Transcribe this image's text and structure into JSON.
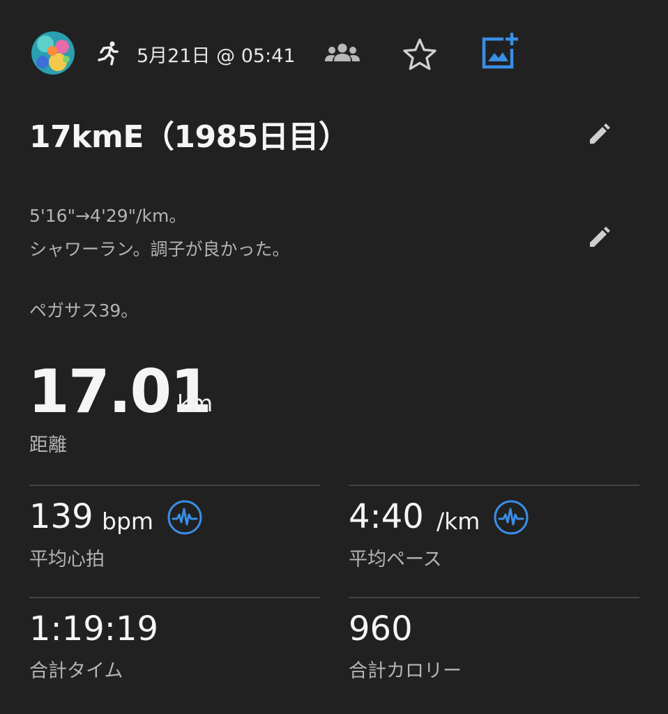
{
  "header": {
    "date_time": "5月21日 @ 05:41",
    "icons": {
      "avatar": "profile-avatar",
      "activity": "running-icon",
      "privacy": "group-icon",
      "favorite": "star-icon",
      "add_photo": "add-photo-icon"
    },
    "accent_color": "#3a8ee6"
  },
  "activity": {
    "title": "17kmE（1985日目）",
    "description_lines": [
      "5'16\"→4'29\"/km。",
      "シャワーラン。調子が良かった。",
      "ペガサス39。"
    ]
  },
  "distance": {
    "value": "17.01",
    "unit": "km",
    "label": "距離"
  },
  "stats": [
    {
      "value": "139",
      "unit": "bpm",
      "label": "平均心拍",
      "has_chart_icon": true
    },
    {
      "value": "4:40",
      "unit": "/km",
      "label": "平均ペース",
      "has_chart_icon": true
    },
    {
      "value": "1:19:19",
      "unit": "",
      "label": "合計タイム",
      "has_chart_icon": false
    },
    {
      "value": "960",
      "unit": "",
      "label": "合計カロリー",
      "has_chart_icon": false
    }
  ]
}
